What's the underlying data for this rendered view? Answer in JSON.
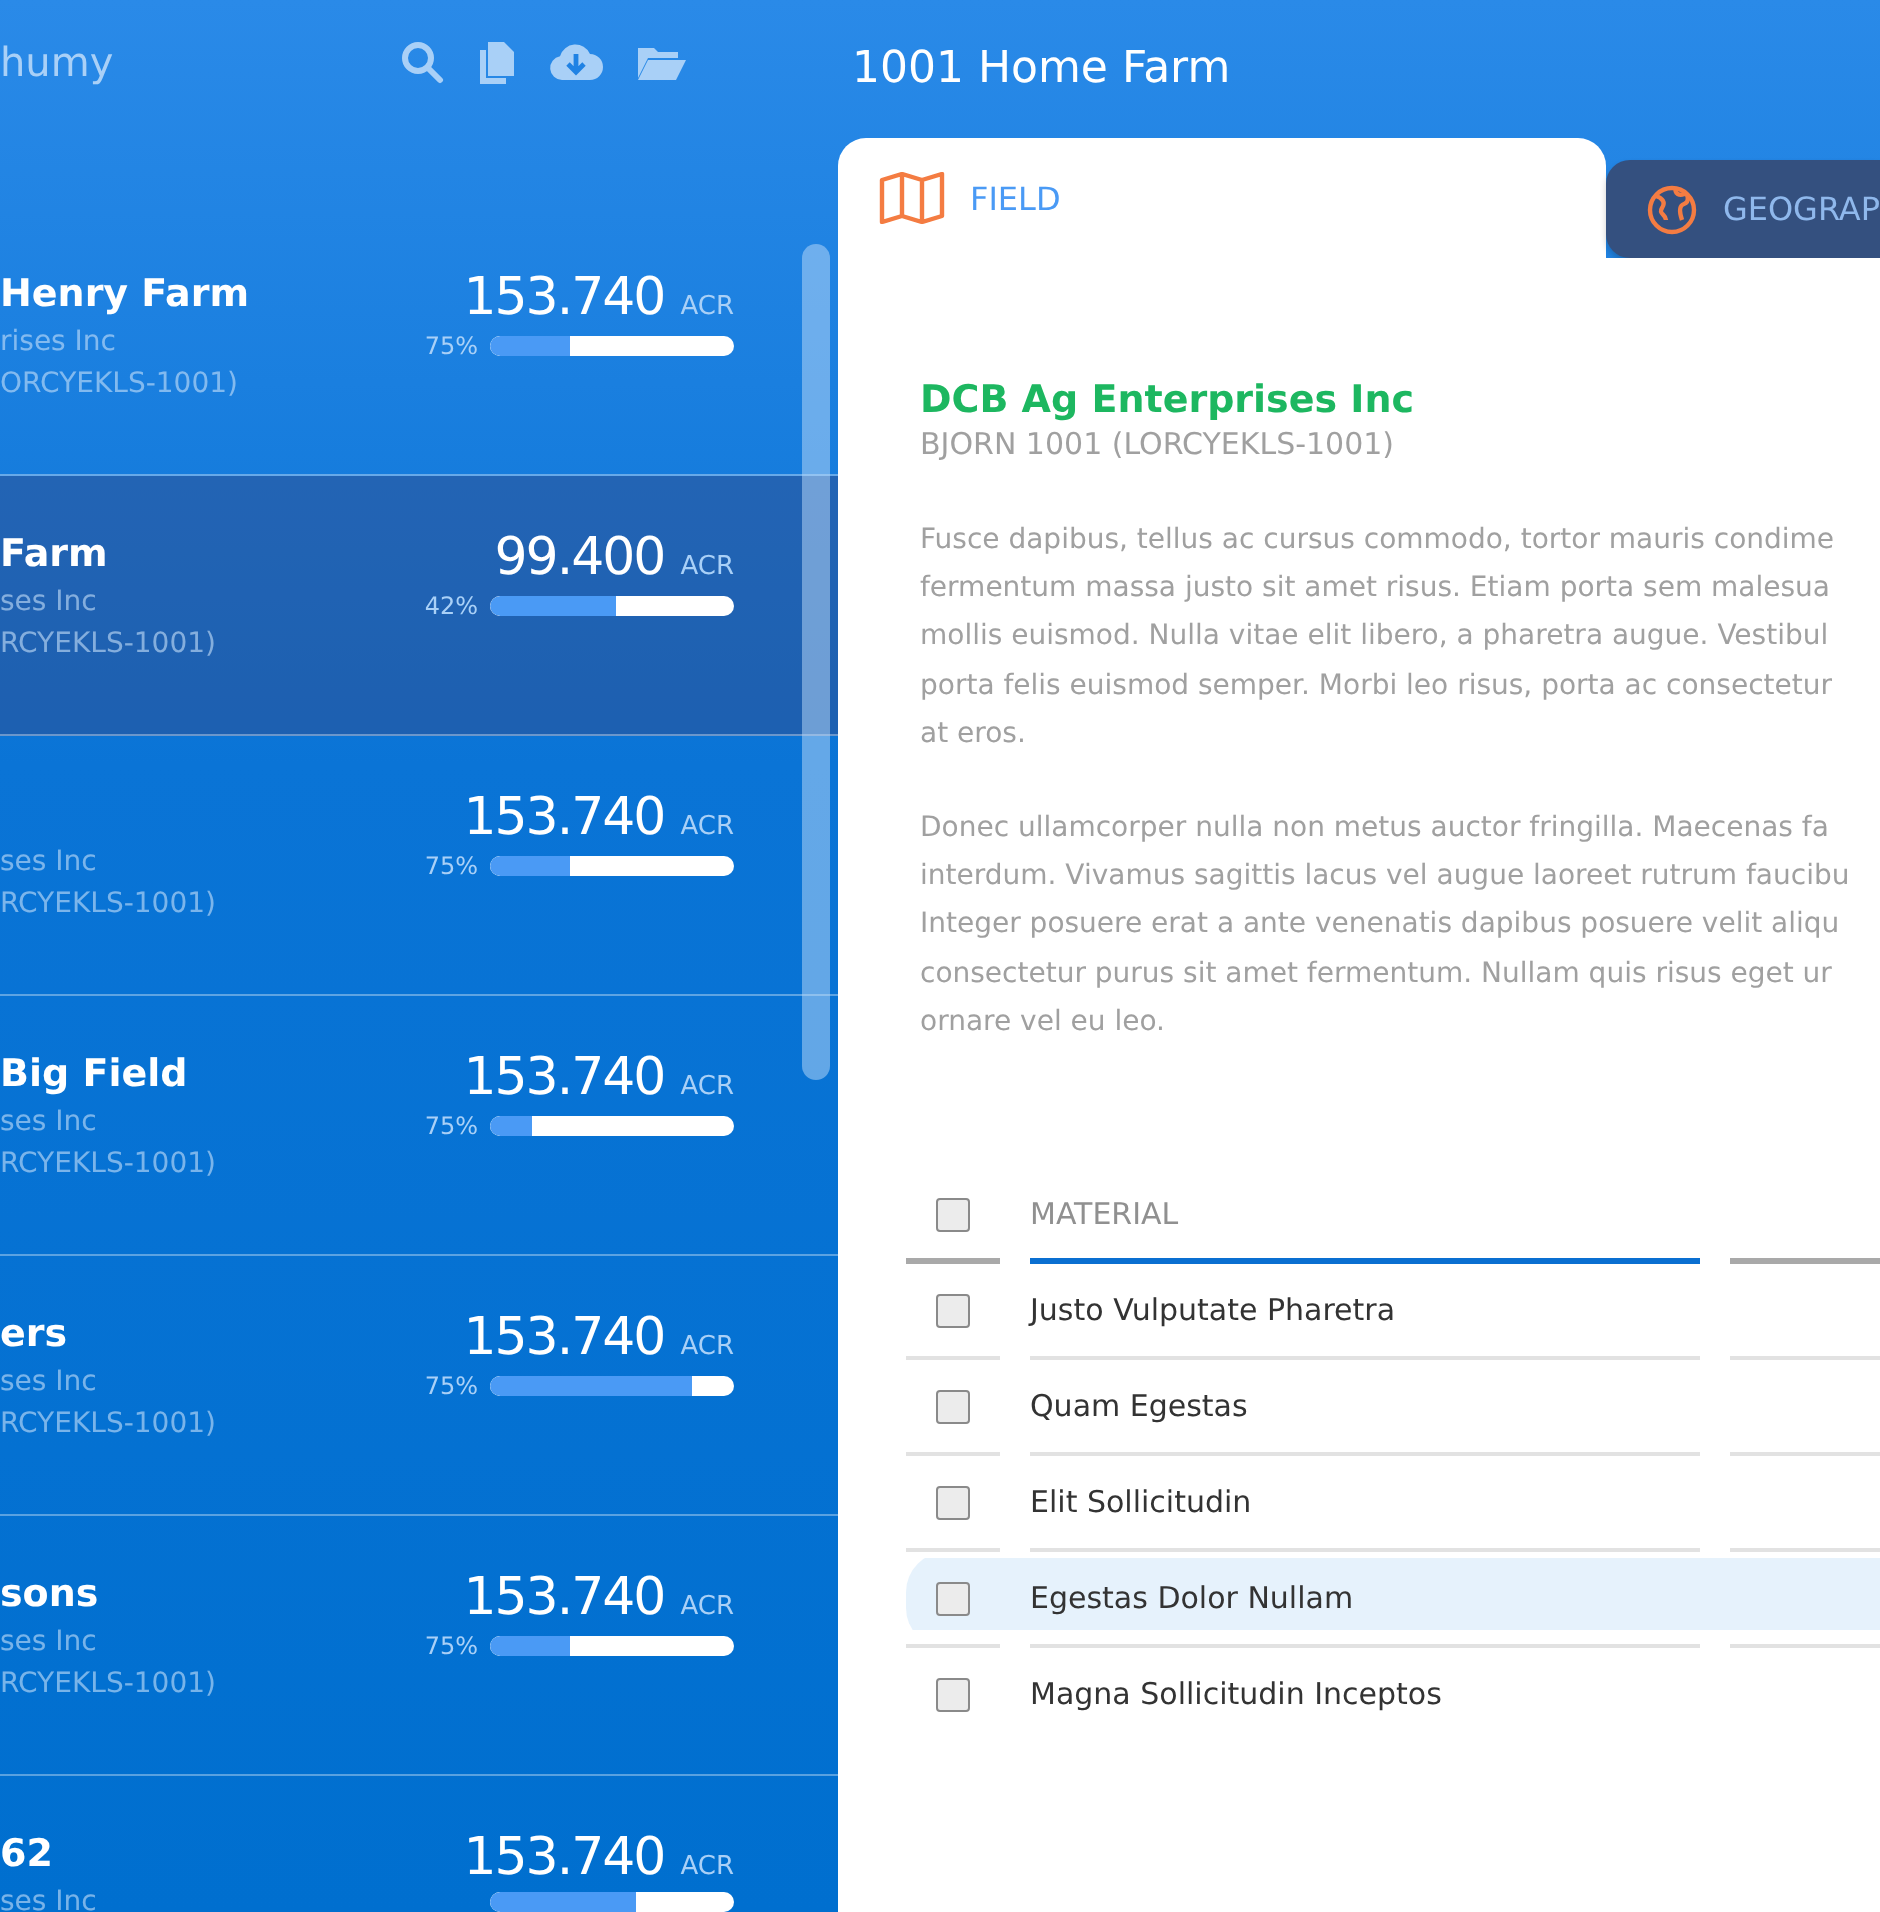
{
  "sidebar": {
    "title": "humy",
    "items": [
      {
        "title": "Henry Farm",
        "subtitle": "rises Inc",
        "code": "ORCYEKLS-1001)",
        "area": "153.740",
        "unit": "ACR",
        "percent": "75%",
        "level": 0.33,
        "selected": false
      },
      {
        "title": "Farm",
        "subtitle": "ses Inc",
        "code": "RCYEKLS-1001)",
        "area": "99.400",
        "unit": "ACR",
        "percent": "42%",
        "level": 0.52,
        "selected": true
      },
      {
        "subtitle": "ses Inc",
        "code": "RCYEKLS-1001)",
        "area": "153.740",
        "unit": "ACR",
        "percent": "75%",
        "level": 0.33,
        "selected": false
      },
      {
        "title": "Big Field",
        "subtitle": "ses Inc",
        "code": "RCYEKLS-1001)",
        "area": "153.740",
        "unit": "ACR",
        "percent": "75%",
        "level": 0.17,
        "selected": false
      },
      {
        "title": "ers",
        "subtitle": "ses Inc",
        "code": "RCYEKLS-1001)",
        "area": "153.740",
        "unit": "ACR",
        "percent": "75%",
        "level": 0.83,
        "selected": false
      },
      {
        "title": "sons",
        "subtitle": "ses Inc",
        "code": "RCYEKLS-1001)",
        "area": "153.740",
        "unit": "ACR",
        "percent": "75%",
        "level": 0.33,
        "selected": false
      },
      {
        "title": "62",
        "subtitle": "ses Inc",
        "area": "153.740",
        "unit": "ACR",
        "level": 0.6,
        "selected": false
      }
    ]
  },
  "header": {
    "title": "1001 Home Farm"
  },
  "tabs": [
    {
      "label": "FIELD",
      "kind": "map",
      "selected": true
    },
    {
      "label": "GEOGRAP",
      "kind": "globe",
      "selected": false
    }
  ],
  "detail": {
    "company": "DCB Ag Enterprises Inc",
    "code": "BJORN 1001 (LORCYEKLS-1001)",
    "paragraphs": [
      [
        "Fusce dapibus, tellus ac cursus commodo, tortor mauris condime",
        "fermentum massa justo sit amet risus. Etiam porta sem malesua",
        "mollis euismod. Nulla vitae elit libero, a pharetra augue. Vestibul",
        "porta felis euismod semper. Morbi leo risus, porta ac consectetur",
        "at eros."
      ],
      [
        "Donec ullamcorper nulla non metus auctor fringilla. Maecenas fa",
        "interdum. Vivamus sagittis lacus vel augue laoreet rutrum faucibu",
        "Integer posuere erat a ante venenatis dapibus posuere velit aliqu",
        "consectetur purus sit amet fermentum. Nullam quis risus eget ur",
        "ornare vel eu leo."
      ]
    ]
  },
  "table": {
    "header_checked": false,
    "columns": [
      "MATERIAL"
    ],
    "rows": [
      {
        "material": "Justo Vulputate Pharetra",
        "checked": false,
        "selected": false
      },
      {
        "material": "Quam Egestas",
        "checked": false,
        "selected": false
      },
      {
        "material": "Elit Sollicitudin",
        "checked": false,
        "selected": false
      },
      {
        "material": "Egestas Dolor Nullam",
        "checked": false,
        "selected": true
      },
      {
        "material": "Magna Sollicitudin Inceptos",
        "checked": false,
        "selected": false
      }
    ]
  }
}
